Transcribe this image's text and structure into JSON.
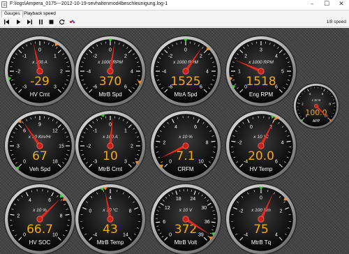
{
  "window": {
    "title": "F:\\logs\\Ampera_0175---2012-10-19-sevhaltenmod4beschleunigung.log-1",
    "minimize_glyph": "–",
    "maximize_glyph": "☐",
    "close_glyph": "✕"
  },
  "menu": {
    "items": [
      "Gauges",
      "Playback speed"
    ]
  },
  "toolbar": {
    "buttons": [
      "previous-button",
      "play-button",
      "next-button",
      "pause-button",
      "stop-button",
      "loop-button",
      "color-button"
    ],
    "speed_label": "1/8 speed"
  },
  "colors": {
    "needle": "#e42a1f",
    "value_text": "#f5a623",
    "label_text": "#ffffff",
    "tick": "#ffffff",
    "min_marker": "#3fc43a",
    "max_marker": "#f08a24",
    "panel": "#464646"
  },
  "gauges": [
    {
      "id": "hv-crnt",
      "label": "HV Crnt",
      "unit": "x 100 A",
      "value_text": "-29",
      "value": -0.29,
      "min": -3,
      "max": 3,
      "ticks": [
        "-3",
        "-2",
        "-1",
        "0",
        "1",
        "2",
        "3"
      ],
      "min_marker": -2.3,
      "max_marker": 0.7
    },
    {
      "id": "mtrb-spd",
      "label": "MtrB Spd",
      "unit": "x 1000 RPM",
      "value_text": "370",
      "value": 0.37,
      "min": -6,
      "max": 6,
      "ticks": [
        "-6",
        "-4",
        "-2",
        "0",
        "2",
        "4",
        "6"
      ],
      "min_marker": 0.0,
      "max_marker": 4.9
    },
    {
      "id": "mtra-spd",
      "label": "MtrA Spd",
      "unit": "x 1000 RPM",
      "value_text": "1525",
      "value": 1.525,
      "min": -6,
      "max": 6,
      "ticks": [
        "-6",
        "-4",
        "-2",
        "0",
        "2",
        "4",
        "6"
      ],
      "min_marker": 0.0,
      "max_marker": 2.0
    },
    {
      "id": "eng-rpm",
      "label": "Eng RPM",
      "unit": "x 1000 RPM",
      "value_text": "1518",
      "value": 1.518,
      "min": 0,
      "max": 6,
      "ticks": [
        "0",
        "1",
        "2",
        "3",
        "4",
        "5",
        "6"
      ],
      "min_marker": 0.35,
      "max_marker": 0.7
    },
    {
      "id": "app",
      "label": "APP",
      "unit": "x 10 %",
      "value_text": "100.0",
      "value": 10,
      "min": 0,
      "max": 10,
      "ticks": [
        "0",
        "2",
        "4",
        "6",
        "8",
        "10"
      ],
      "min_marker": 0,
      "max_marker": 10
    },
    {
      "id": "veh-spd",
      "label": "Veh Spd",
      "unit": "x 10 Km/Hr",
      "value_text": "67",
      "value": 6.7,
      "min": 0,
      "max": 18,
      "ticks": [
        "0",
        "3",
        "6",
        "9",
        "12",
        "15",
        "18"
      ],
      "min_marker": 0,
      "max_marker": 6.4
    },
    {
      "id": "mtrb-crnt",
      "label": "MtrB Crnt",
      "unit": "x 100 A",
      "value_text": "10",
      "value": 0.1,
      "min": -3,
      "max": 3,
      "ticks": [
        "-3",
        "-2",
        "-1",
        "0",
        "1",
        "2",
        "3"
      ],
      "min_marker": -0.3,
      "max_marker": 2.7
    },
    {
      "id": "crfm",
      "label": "CRFM",
      "unit": "x 10 %",
      "value_text": "7.1",
      "value": 0.71,
      "min": 0,
      "max": 10,
      "ticks": [
        "0",
        "2",
        "4",
        "6",
        "8",
        "10"
      ],
      "min_marker": 0.2,
      "max_marker": 0.2
    },
    {
      "id": "hv-temp",
      "label": "HV Temp",
      "unit": "x 10 °C",
      "value_text": "20.0",
      "value": 2.0,
      "min": -4,
      "max": 6,
      "ticks": [
        "-4",
        "-2",
        "0",
        "2",
        "4",
        "6"
      ],
      "min_marker": 1.8,
      "max_marker": 2.05
    },
    {
      "id": "hv-soc",
      "label": "HV SOC",
      "unit": "x 10 %",
      "value_text": "66.7",
      "value": 6.67,
      "min": 0,
      "max": 10,
      "ticks": [
        "0",
        "2",
        "4",
        "6",
        "8",
        "10"
      ],
      "min_marker": 6.6,
      "max_marker": 6.9
    },
    {
      "id": "mtrb-temp",
      "label": "MtrB Temp",
      "unit": "x 10 °C",
      "value_text": "43",
      "value": 4.3,
      "min": -4,
      "max": 14,
      "ticks": [
        "-4",
        "0",
        "4",
        "8",
        "14"
      ],
      "min_marker": 4.0,
      "max_marker": 4.4
    },
    {
      "id": "mtrb-volt",
      "label": "MtrB Volt",
      "unit": "x 10 V",
      "value_text": "372",
      "value": 37.2,
      "min": 0,
      "max": 39,
      "ticks": [
        "0",
        "6",
        "12",
        "18",
        "24",
        "30",
        "36",
        "39"
      ],
      "min_marker": 36.5,
      "max_marker": 37.8
    },
    {
      "id": "mtrb-tq",
      "label": "MtrB Tq",
      "unit": "x 100 Nm",
      "value_text": "75",
      "value": 0.75,
      "min": -4,
      "max": 4,
      "ticks": [
        "-4",
        "-2",
        "0",
        "2",
        "4"
      ],
      "min_marker": 0.0,
      "max_marker": 1.5
    }
  ]
}
